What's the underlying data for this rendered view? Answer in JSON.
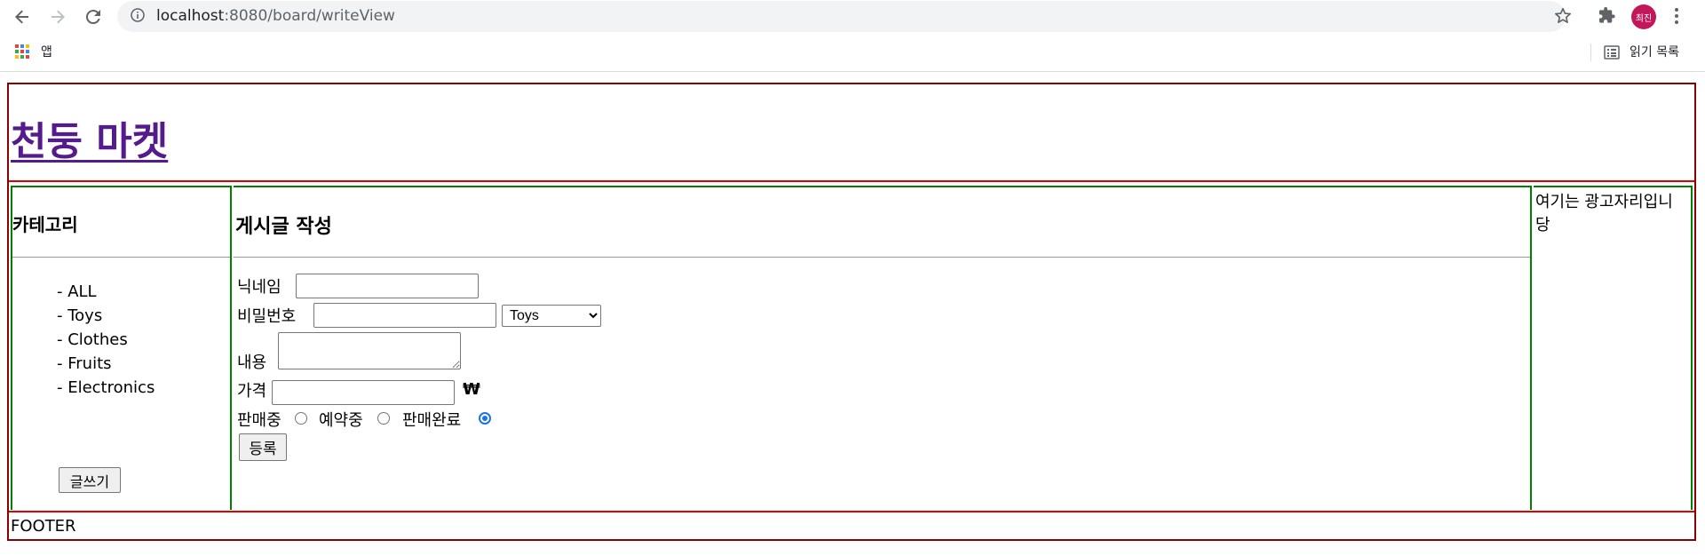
{
  "browser": {
    "url_host": "localhost",
    "url_path": ":8080/board/writeView",
    "profile_initials": "최진",
    "bookmarks": {
      "apps_label": "앱",
      "reading_list_label": "읽기 목록"
    }
  },
  "header": {
    "site_title": "천둥 마켓"
  },
  "sidebar": {
    "title": "카테고리",
    "items": [
      "- ALL",
      "- Toys",
      "- Clothes",
      "- Fruits",
      "- Electronics"
    ],
    "write_button": "글쓰기"
  },
  "form": {
    "title": "게시글 작성",
    "nickname_label": "닉네임",
    "nickname_value": "",
    "password_label": "비밀번호",
    "password_value": "",
    "category_selected": "Toys",
    "content_label": "내용",
    "content_value": "",
    "price_label": "가격",
    "price_value": "",
    "currency_symbol": "₩",
    "status_options": [
      {
        "label": "판매중",
        "checked": false
      },
      {
        "label": "예약중",
        "checked": false
      },
      {
        "label": "판매완료",
        "checked": true
      }
    ],
    "submit_button": "등록"
  },
  "ad": {
    "text": "여기는 광고자리입니당"
  },
  "footer": {
    "text": "FOOTER"
  },
  "colors": {
    "outer_border": "#8b0000",
    "section_border": "#e00000",
    "column_border": "#008000",
    "link_visited": "#551a8b"
  }
}
